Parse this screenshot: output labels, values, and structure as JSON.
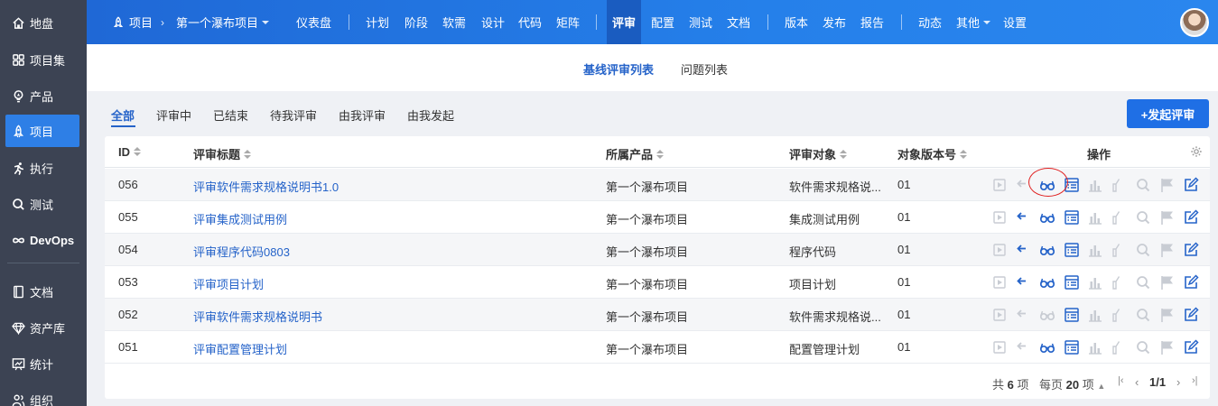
{
  "sidebar": {
    "items": [
      {
        "label": "地盘",
        "icon": "home-icon"
      },
      {
        "label": "项目集",
        "icon": "grid-icon"
      },
      {
        "label": "产品",
        "icon": "lightbulb-icon"
      },
      {
        "label": "项目",
        "icon": "rocket-icon",
        "active": true
      },
      {
        "label": "执行",
        "icon": "run-icon"
      },
      {
        "label": "测试",
        "icon": "search-icon"
      },
      {
        "label": "DevOps",
        "icon": "infinity-icon"
      },
      {
        "label": "文档",
        "icon": "book-icon"
      },
      {
        "label": "资产库",
        "icon": "diamond-icon"
      },
      {
        "label": "统计",
        "icon": "chart-icon"
      },
      {
        "label": "组织",
        "icon": "people-icon"
      }
    ]
  },
  "header": {
    "module": "项目",
    "project": "第一个瀑布项目",
    "nav": [
      "仪表盘",
      "计划",
      "阶段",
      "软需",
      "设计",
      "代码",
      "矩阵",
      "评审",
      "配置",
      "测试",
      "文档",
      "版本",
      "发布",
      "报告",
      "动态",
      "其他",
      "设置"
    ],
    "active": "评审"
  },
  "subnav": {
    "items": [
      "基线评审列表",
      "问题列表"
    ],
    "active": "基线评审列表"
  },
  "tabs": {
    "items": [
      "全部",
      "评审中",
      "已结束",
      "待我评审",
      "由我评审",
      "由我发起"
    ],
    "active": "全部"
  },
  "create_button": "+发起评审",
  "table": {
    "columns": [
      "ID",
      "评审标题",
      "所属产品",
      "评审对象",
      "对象版本号",
      "操作"
    ],
    "rows": [
      {
        "id": "056",
        "title": "评审软件需求规格说明书1.0",
        "product": "第一个瀑布项目",
        "object": "软件需求规格说...",
        "version": "01"
      },
      {
        "id": "055",
        "title": "评审集成测试用例",
        "product": "第一个瀑布项目",
        "object": "集成测试用例",
        "version": "01"
      },
      {
        "id": "054",
        "title": "评审程序代码0803",
        "product": "第一个瀑布项目",
        "object": "程序代码",
        "version": "01"
      },
      {
        "id": "053",
        "title": "评审项目计划",
        "product": "第一个瀑布项目",
        "object": "项目计划",
        "version": "01"
      },
      {
        "id": "052",
        "title": "评审软件需求规格说明书",
        "product": "第一个瀑布项目",
        "object": "软件需求规格说...",
        "version": "01"
      },
      {
        "id": "051",
        "title": "评审配置管理计划",
        "product": "第一个瀑布项目",
        "object": "配置管理计划",
        "version": "01"
      }
    ],
    "action_icons": [
      "submit-icon",
      "undo-icon",
      "glasses-icon",
      "list-icon",
      "bar-chart-icon",
      "thumbs-up-icon",
      "search-icon",
      "flag-icon",
      "edit-icon"
    ],
    "action_enabled": [
      [
        false,
        false,
        true,
        true,
        false,
        false,
        false,
        false,
        true
      ],
      [
        false,
        true,
        true,
        true,
        false,
        false,
        false,
        false,
        true
      ],
      [
        false,
        true,
        true,
        true,
        false,
        false,
        false,
        false,
        true
      ],
      [
        false,
        true,
        true,
        true,
        false,
        false,
        false,
        false,
        true
      ],
      [
        false,
        false,
        false,
        true,
        false,
        false,
        false,
        false,
        true
      ],
      [
        false,
        false,
        true,
        true,
        false,
        false,
        false,
        false,
        true
      ]
    ]
  },
  "pager": {
    "total_prefix": "共",
    "total": "6",
    "total_suffix": "项",
    "per_page_prefix": "每页",
    "per_page": "20",
    "per_page_suffix": "项",
    "page": "1/1"
  },
  "colors": {
    "accent": "#2563c9",
    "sidebar": "#3c4353",
    "header": "#2580ea",
    "disabled_icon": "#c8ccd3"
  }
}
